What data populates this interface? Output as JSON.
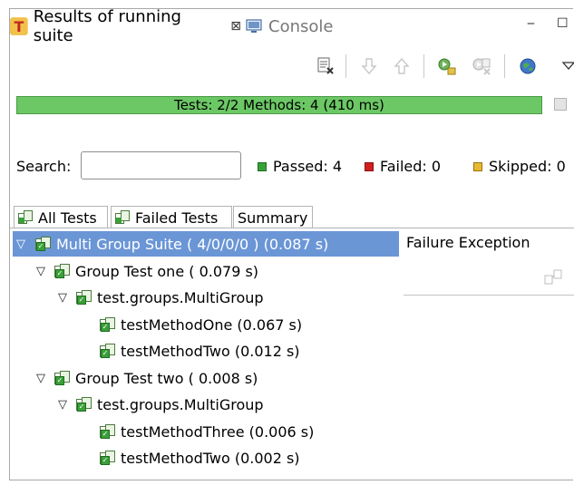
{
  "tabs": {
    "results_label": "Results of running suite",
    "results_close": "⊠",
    "console_label": "Console"
  },
  "window_controls": {
    "minimize": "‒",
    "maximize": "☐"
  },
  "toolbar": {
    "icons": [
      "export-results-icon",
      "next-failure-icon",
      "previous-failure-icon",
      "rerun-icon",
      "rerun-failed-icon",
      "open-report-icon",
      "view-menu-icon"
    ]
  },
  "progress": {
    "label": "Tests: 2/2  Methods: 4 (410 ms)",
    "fraction": 1.0,
    "color": "#6cc865"
  },
  "search": {
    "label": "Search:",
    "value": "",
    "placeholder": ""
  },
  "counters": {
    "passed": "Passed: 4",
    "failed": "Failed: 0",
    "skipped": "Skipped: 0",
    "passed_color": "#3aa03a",
    "failed_color": "#d02020",
    "skipped_color": "#e8b830"
  },
  "subtabs": {
    "all_tests": "All Tests",
    "failed_tests": "Failed Tests",
    "summary": "Summary"
  },
  "tree": [
    {
      "label": "Multi Group Suite ( 4/0/0/0 ) (0.087 s)",
      "twisty": "▽",
      "selected": true
    },
    {
      "label": "Group Test one ( 0.079 s)",
      "twisty": "▽"
    },
    {
      "label": "test.groups.MultiGroup",
      "twisty": "▽"
    },
    {
      "label": "testMethodOne  (0.067 s)",
      "twisty": ""
    },
    {
      "label": "testMethodTwo  (0.012 s)",
      "twisty": ""
    },
    {
      "label": "Group Test two ( 0.008 s)",
      "twisty": "▽"
    },
    {
      "label": "test.groups.MultiGroup",
      "twisty": "▽"
    },
    {
      "label": "testMethodThree  (0.006 s)",
      "twisty": ""
    },
    {
      "label": "testMethodTwo  (0.002 s)",
      "twisty": ""
    }
  ],
  "failure_panel": {
    "title": "Failure Exception"
  },
  "accent": {
    "selection": "#6b96d6"
  }
}
